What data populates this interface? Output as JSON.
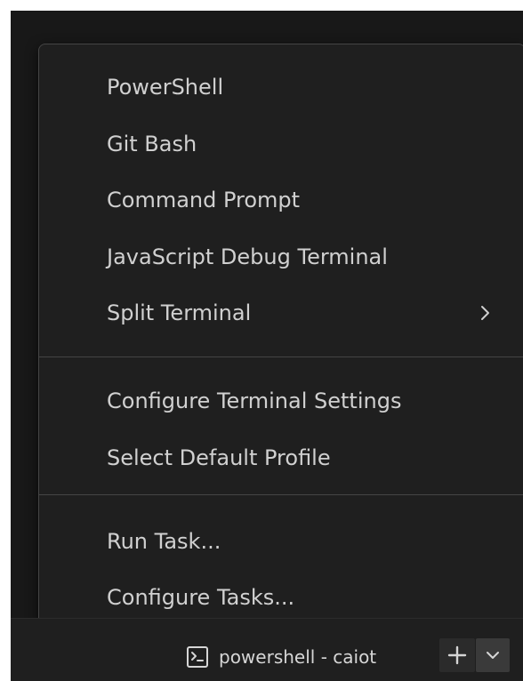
{
  "menu": {
    "groups": [
      {
        "items": [
          {
            "label": "PowerShell"
          },
          {
            "label": "Git Bash"
          },
          {
            "label": "Command Prompt"
          },
          {
            "label": "JavaScript Debug Terminal"
          },
          {
            "label": "Split Terminal",
            "has_submenu": true
          }
        ]
      },
      {
        "items": [
          {
            "label": "Configure Terminal Settings"
          },
          {
            "label": "Select Default Profile"
          }
        ]
      },
      {
        "items": [
          {
            "label": "Run Task..."
          },
          {
            "label": "Configure Tasks..."
          }
        ]
      }
    ]
  },
  "panel": {
    "terminal_tab_label": "powershell - caiot"
  },
  "colors": {
    "window_background": "#181818",
    "menu_background": "#1f1f1f",
    "menu_border": "#454545",
    "text": "#d0d0d0"
  },
  "icons": {
    "terminal": "terminal-icon",
    "add": "plus-icon",
    "dropdown": "chevron-down-icon",
    "submenu": "chevron-right-icon"
  }
}
